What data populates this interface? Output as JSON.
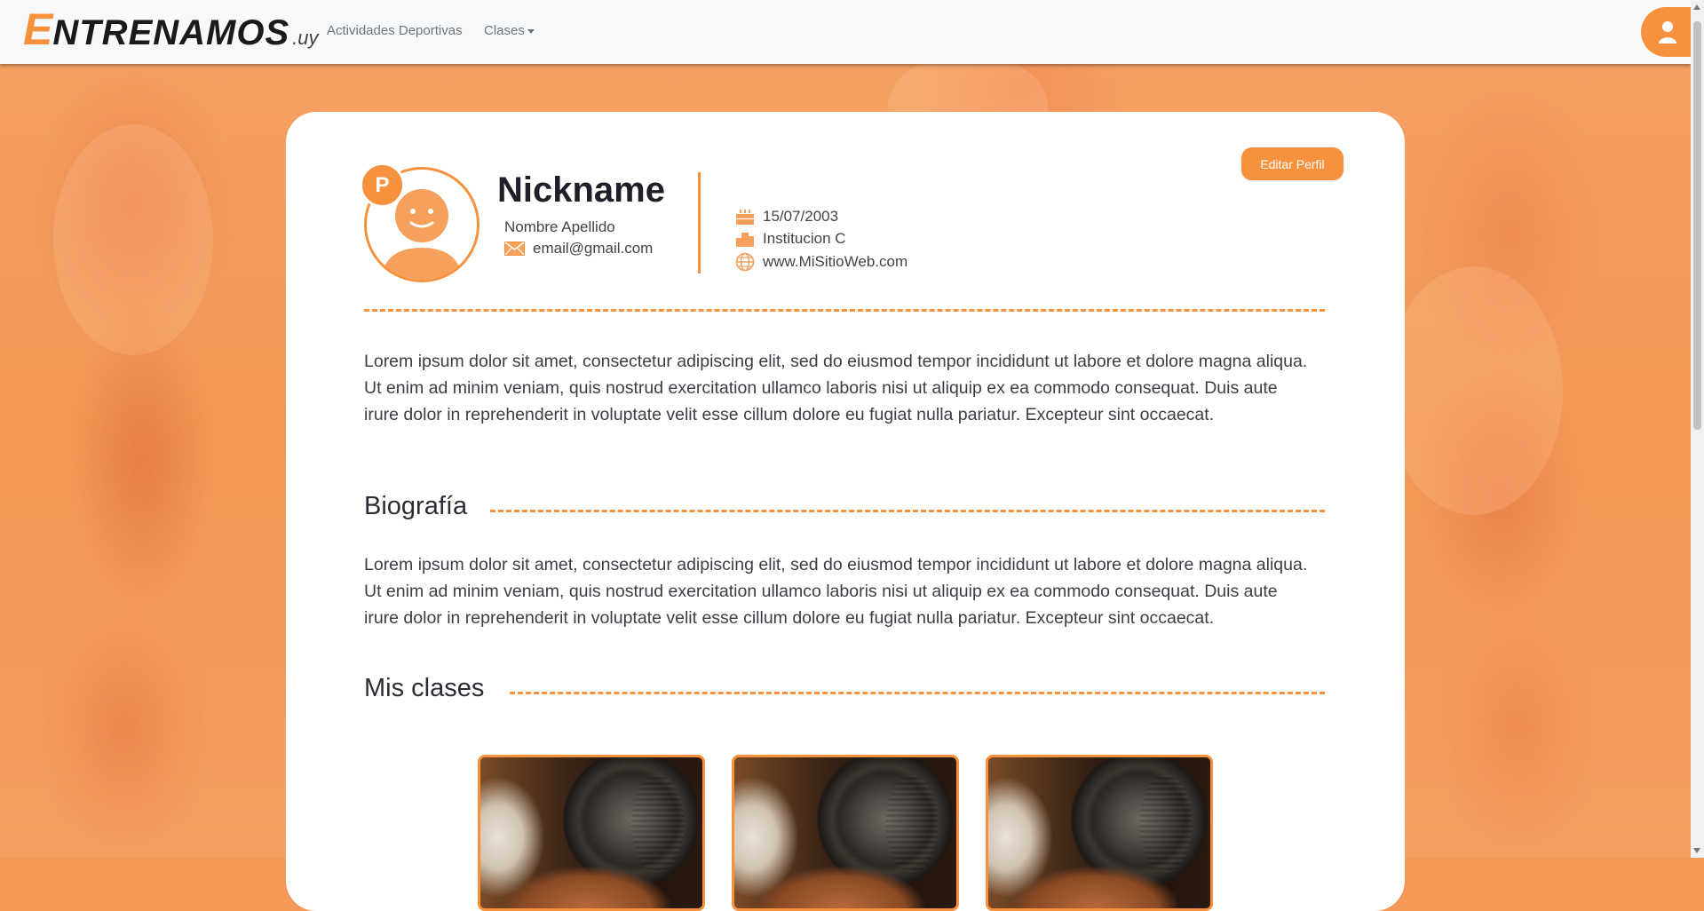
{
  "navbar": {
    "brand_first": "E",
    "brand_rest": "NTRENAMOS",
    "brand_suffix": ".uy",
    "links": [
      "Actividades Deportivas",
      "Clases"
    ]
  },
  "profile": {
    "edit_label": "Editar Perfil",
    "badge": "P",
    "nickname": "Nickname",
    "full_name": "Nombre Apellido",
    "email": "email@gmail.com",
    "birth_date": "15/07/2003",
    "institution": "Institucion C",
    "website": "www.MiSitioWeb.com"
  },
  "description": "Lorem ipsum dolor sit amet, consectetur adipiscing elit, sed do eiusmod tempor incididunt ut labore et dolore magna aliqua. Ut enim ad minim veniam, quis nostrud exercitation ullamco laboris nisi ut aliquip ex ea commodo consequat. Duis aute irure dolor in reprehenderit in voluptate velit esse cillum dolore eu fugiat nulla pariatur. Excepteur sint occaecat.",
  "biography": {
    "title": "Biografía",
    "text": "Lorem ipsum dolor sit amet, consectetur adipiscing elit, sed do eiusmod tempor incididunt ut labore et dolore magna aliqua. Ut enim ad minim veniam, quis nostrud exercitation ullamco laboris nisi ut aliquip ex ea commodo consequat. Duis aute irure dolor in reprehenderit in voluptate velit esse cillum dolore eu fugiat nulla pariatur. Excepteur sint occaecat."
  },
  "classes": {
    "title": "Mis clases",
    "count": 3
  },
  "colors": {
    "accent": "#f7913d",
    "background": "#f39a59"
  },
  "icons": [
    "user-icon",
    "email-icon",
    "cake-icon",
    "institution-icon",
    "globe-icon"
  ]
}
